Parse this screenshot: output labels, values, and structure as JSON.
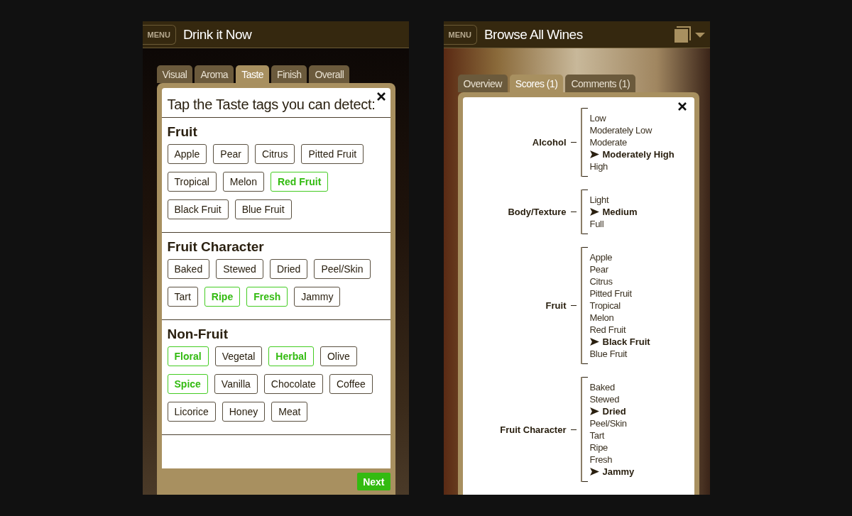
{
  "left_screen": {
    "menu_button": "MENU",
    "title": "Drink it Now",
    "tabs": [
      {
        "label": "Visual",
        "selected": false
      },
      {
        "label": "Aroma",
        "selected": false
      },
      {
        "label": "Taste",
        "selected": true
      },
      {
        "label": "Finish",
        "selected": false
      },
      {
        "label": "Overall",
        "selected": false
      }
    ],
    "instruction": "Tap the Taste tags you can detect:",
    "sections": [
      {
        "title": "Fruit",
        "tags": [
          {
            "label": "Apple",
            "selected": false
          },
          {
            "label": "Pear",
            "selected": false
          },
          {
            "label": "Citrus",
            "selected": false
          },
          {
            "label": "Pitted Fruit",
            "selected": false
          },
          {
            "label": "Tropical",
            "selected": false
          },
          {
            "label": "Melon",
            "selected": false
          },
          {
            "label": "Red Fruit",
            "selected": true
          },
          {
            "label": "Black Fruit",
            "selected": false
          },
          {
            "label": "Blue Fruit",
            "selected": false
          }
        ]
      },
      {
        "title": "Fruit Character",
        "tags": [
          {
            "label": "Baked",
            "selected": false
          },
          {
            "label": "Stewed",
            "selected": false
          },
          {
            "label": "Dried",
            "selected": false
          },
          {
            "label": "Peel/Skin",
            "selected": false
          },
          {
            "label": "Tart",
            "selected": false
          },
          {
            "label": "Ripe",
            "selected": true
          },
          {
            "label": "Fresh",
            "selected": true
          },
          {
            "label": "Jammy",
            "selected": false
          }
        ]
      },
      {
        "title": "Non-Fruit",
        "tags": [
          {
            "label": "Floral",
            "selected": true
          },
          {
            "label": "Vegetal",
            "selected": false
          },
          {
            "label": "Herbal",
            "selected": true
          },
          {
            "label": "Olive",
            "selected": false
          },
          {
            "label": "Spice",
            "selected": true
          },
          {
            "label": "Vanilla",
            "selected": false
          },
          {
            "label": "Chocolate",
            "selected": false
          },
          {
            "label": "Coffee",
            "selected": false
          },
          {
            "label": "Licorice",
            "selected": false
          },
          {
            "label": "Honey",
            "selected": false
          },
          {
            "label": "Meat",
            "selected": false
          }
        ]
      }
    ],
    "next_button": "Next"
  },
  "right_screen": {
    "menu_button": "MENU",
    "title": "Browse All Wines",
    "tabs": [
      {
        "label": "Overview",
        "selected": false
      },
      {
        "label": "Scores (1)",
        "selected": true
      },
      {
        "label": "Comments (1)",
        "selected": false
      }
    ],
    "scores": [
      {
        "label": "Alcohol",
        "options": [
          {
            "label": "Low",
            "selected": false
          },
          {
            "label": "Moderately Low",
            "selected": false
          },
          {
            "label": "Moderate",
            "selected": false
          },
          {
            "label": "Moderately High",
            "selected": true
          },
          {
            "label": "High",
            "selected": false
          }
        ]
      },
      {
        "label": "Body/Texture",
        "options": [
          {
            "label": "Light",
            "selected": false
          },
          {
            "label": "Medium",
            "selected": true
          },
          {
            "label": "Full",
            "selected": false
          }
        ]
      },
      {
        "label": "Fruit",
        "options": [
          {
            "label": "Apple",
            "selected": false
          },
          {
            "label": "Pear",
            "selected": false
          },
          {
            "label": "Citrus",
            "selected": false
          },
          {
            "label": "Pitted Fruit",
            "selected": false
          },
          {
            "label": "Tropical",
            "selected": false
          },
          {
            "label": "Melon",
            "selected": false
          },
          {
            "label": "Red Fruit",
            "selected": false
          },
          {
            "label": "Black Fruit",
            "selected": true
          },
          {
            "label": "Blue Fruit",
            "selected": false
          }
        ]
      },
      {
        "label": "Fruit Character",
        "options": [
          {
            "label": "Baked",
            "selected": false
          },
          {
            "label": "Stewed",
            "selected": false
          },
          {
            "label": "Dried",
            "selected": true
          },
          {
            "label": "Peel/Skin",
            "selected": false
          },
          {
            "label": "Tart",
            "selected": false
          },
          {
            "label": "Ripe",
            "selected": false
          },
          {
            "label": "Fresh",
            "selected": false
          },
          {
            "label": "Jammy",
            "selected": true
          }
        ]
      }
    ]
  }
}
